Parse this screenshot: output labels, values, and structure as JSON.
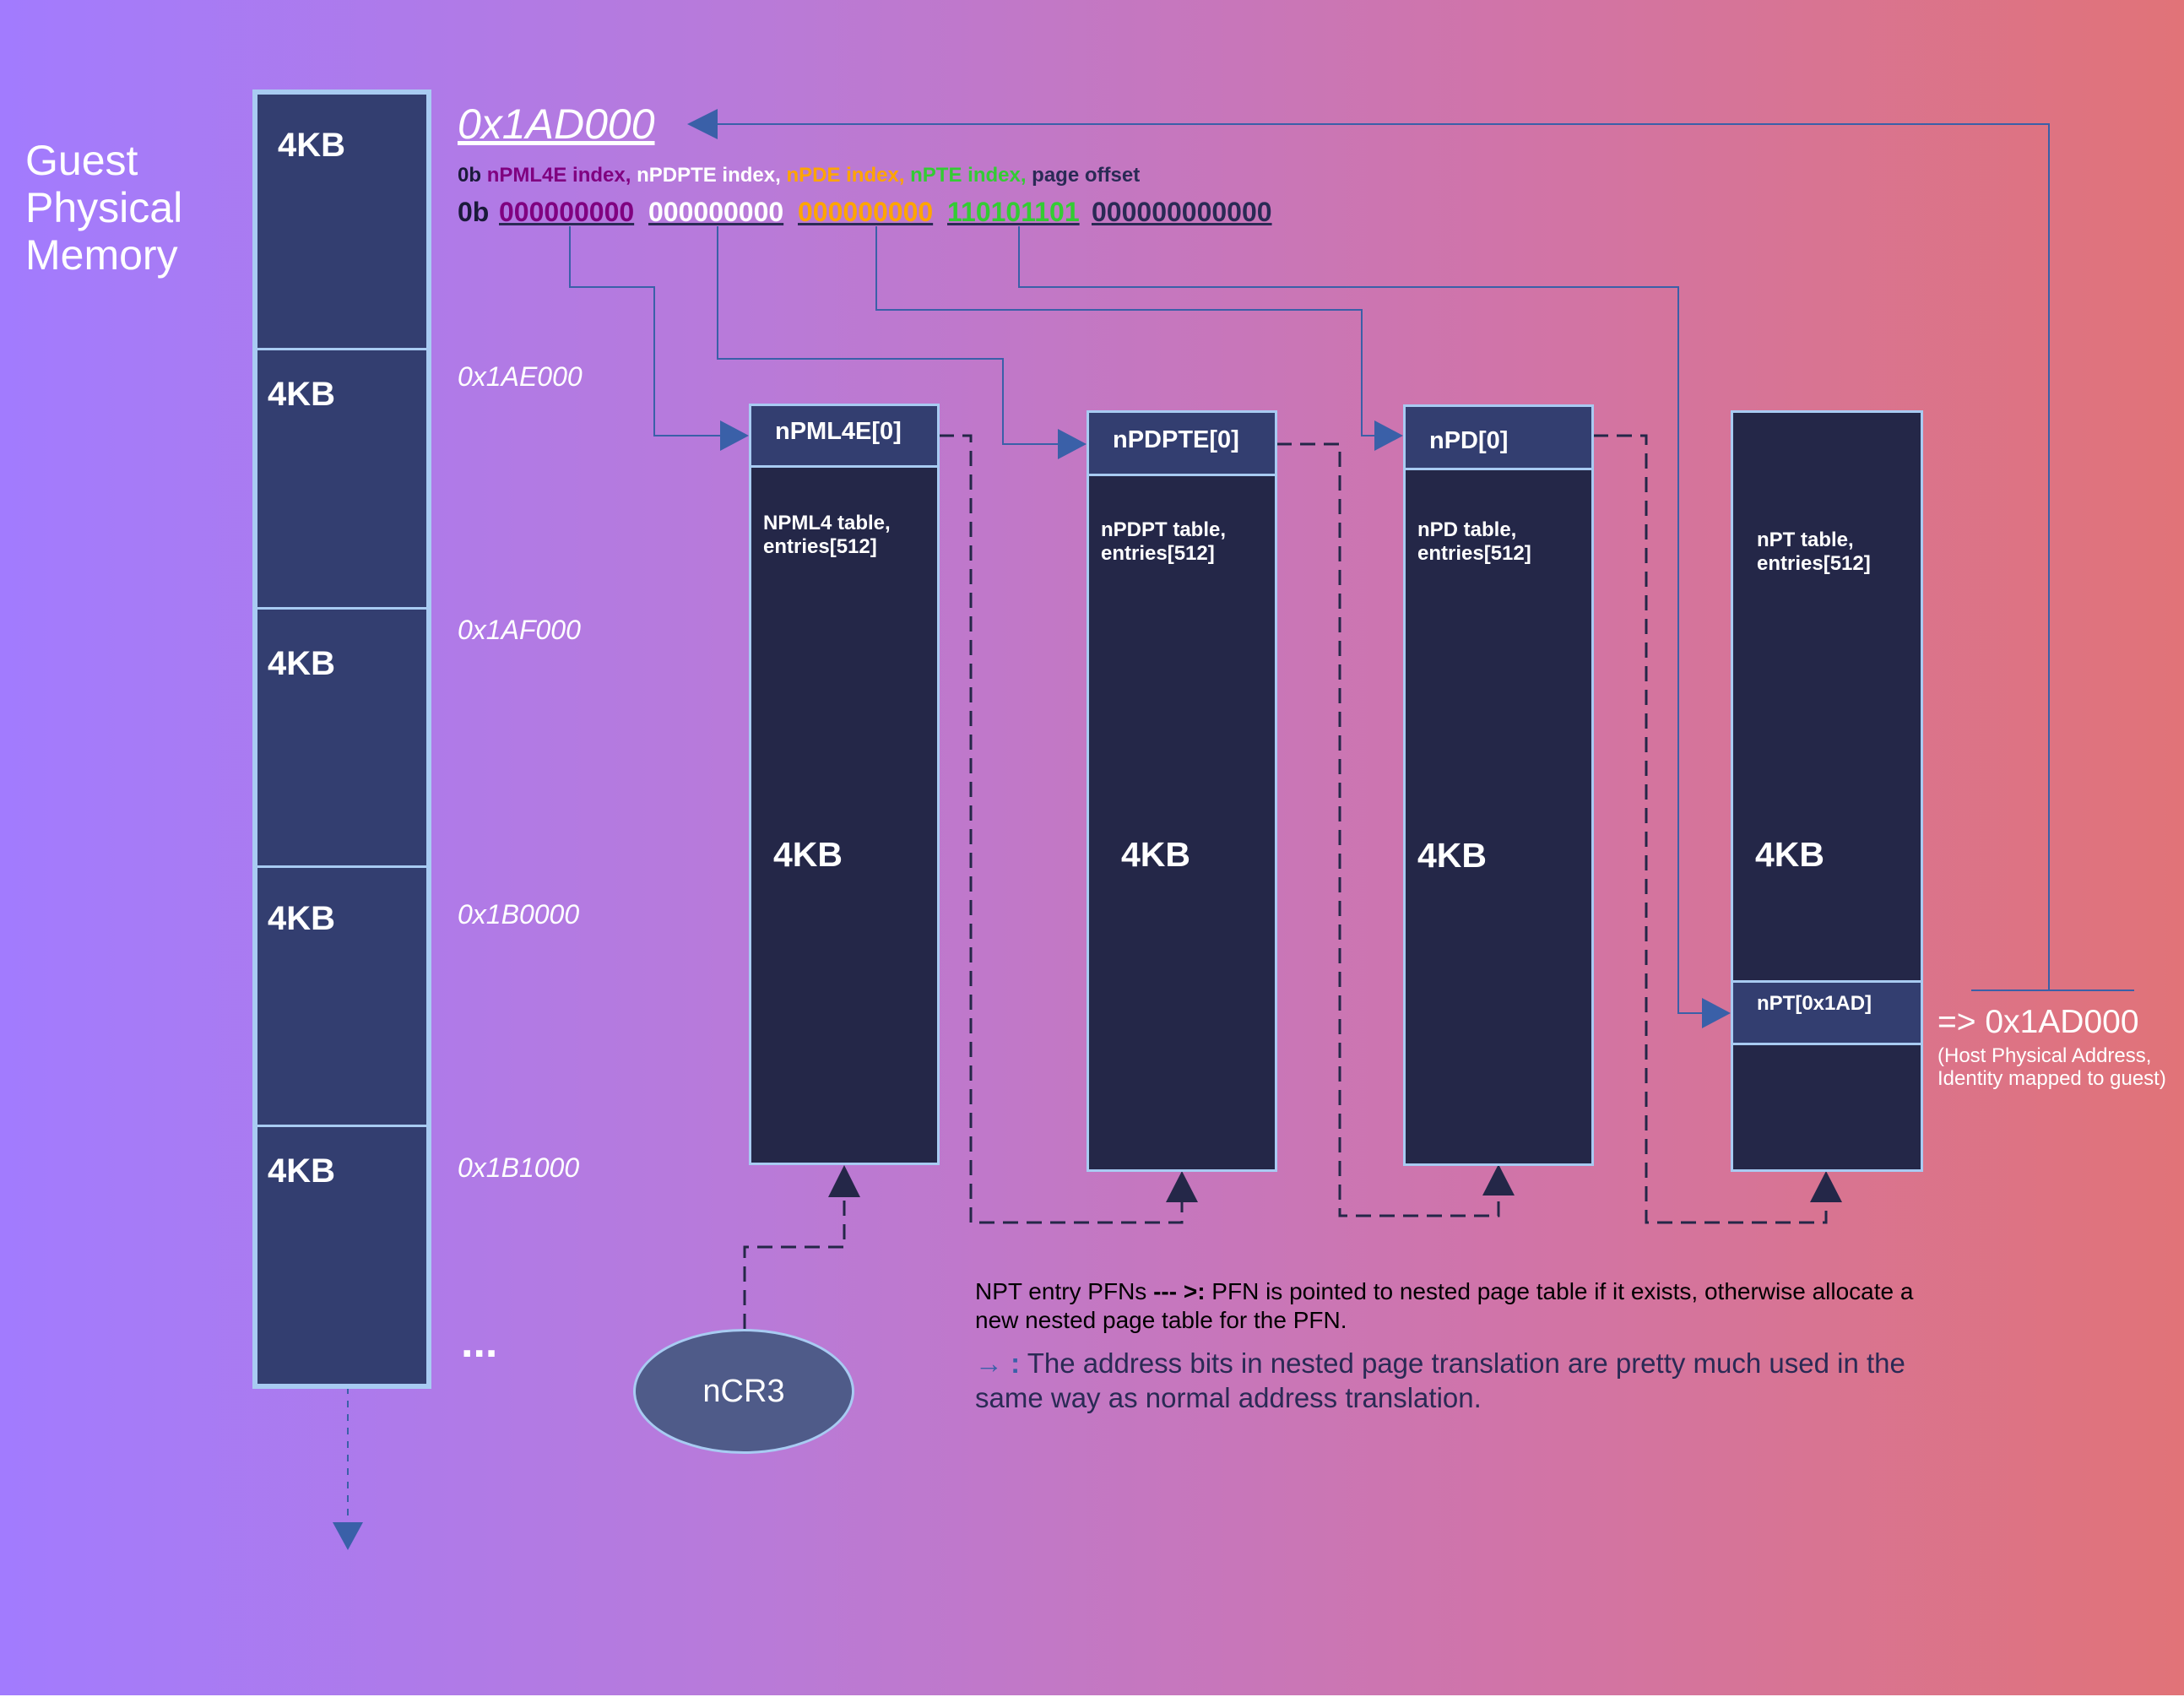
{
  "title": {
    "line1": "Guest",
    "line2": "Physical",
    "line3": "Memory"
  },
  "memory": {
    "blocks": [
      {
        "size": "4KB",
        "address": "0x1AD000"
      },
      {
        "size": "4KB",
        "address": "0x1AE000"
      },
      {
        "size": "4KB",
        "address": "0x1AF000"
      },
      {
        "size": "4KB",
        "address": "0x1B0000"
      },
      {
        "size": "4KB",
        "address": "0x1B1000"
      }
    ],
    "ellipsis": "..."
  },
  "address_format": {
    "prefix": "0b",
    "npml4e": "nPML4E index,",
    "npdpte": "nPDPTE index,",
    "npde": "nPDE index,",
    "npte": "nPTE index,",
    "offset": "page offset"
  },
  "address_bits": {
    "prefix": "0b",
    "npml4e": "000000000",
    "npdpte": "000000000",
    "npde": "000000000",
    "npte": "110101101",
    "offset": "000000000000"
  },
  "tables": [
    {
      "entry": "nPML4E[0]",
      "desc": "NPML4 table,\nentries[512]",
      "size": "4KB"
    },
    {
      "entry": "nPDPTE[0]",
      "desc": "nPDPT table,\nentries[512]",
      "size": "4KB"
    },
    {
      "entry": "nPD[0]",
      "desc": "nPD table,\nentries[512]",
      "size": "4KB"
    },
    {
      "entry": "nPT[0x1AD]",
      "desc": "nPT table,\nentries[512]",
      "size": "4KB"
    }
  ],
  "result": {
    "address": "=> 0x1AD000",
    "note1": "(Host Physical Address,",
    "note2": "Identity mapped to guest)"
  },
  "ncr3": "nCR3",
  "notes": {
    "line1_a": "NPT entry PFNs ",
    "line1_b": "--- >:",
    "line1_c": " PFN is pointed to nested page table if it exists, otherwise allocate a",
    "line2": "new nested page table for the PFN.",
    "line3_arrow": "→",
    "line3_colon": " :",
    "line3_text": " The address bits in nested page translation are pretty much used in the",
    "line4": "same way as normal address translation."
  },
  "colors": {
    "npml4e": "#800080",
    "npdpte": "#ffffff",
    "npde": "#ffa500",
    "npte": "#33cc33",
    "offset": "#2a2a55",
    "block": "#333e70",
    "table": "#242748",
    "border": "#a8cbf2",
    "wire": "#3a60a8"
  }
}
